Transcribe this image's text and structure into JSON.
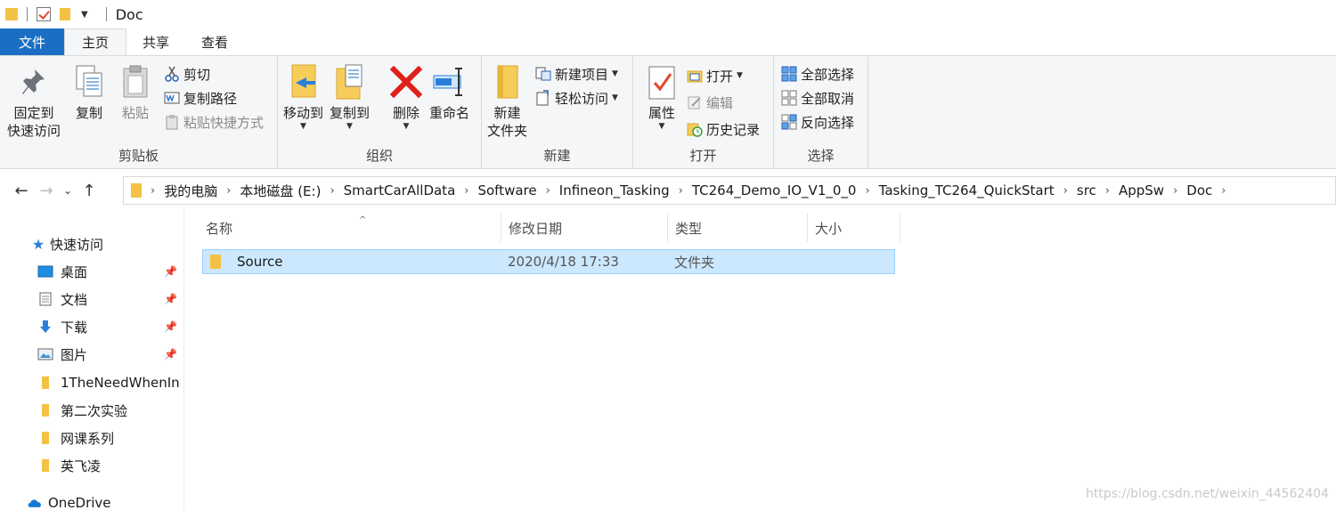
{
  "window": {
    "title": "Doc"
  },
  "tabs": [
    {
      "label": "文件"
    },
    {
      "label": "主页"
    },
    {
      "label": "共享"
    },
    {
      "label": "查看"
    }
  ],
  "ribbon": {
    "clipboard": {
      "label": "剪贴板",
      "pin": "固定到\n快速访问",
      "pin_line1": "固定到",
      "pin_line2": "快速访问",
      "copy": "复制",
      "paste": "粘贴",
      "cut": "剪切",
      "copy_path": "复制路径",
      "paste_shortcut": "粘贴快捷方式"
    },
    "organize": {
      "label": "组织",
      "move_to": "移动到",
      "copy_to": "复制到",
      "delete": "删除",
      "rename": "重命名"
    },
    "new": {
      "label": "新建",
      "new_folder_line1": "新建",
      "new_folder_line2": "文件夹",
      "new_item": "新建项目",
      "easy_access": "轻松访问"
    },
    "open": {
      "label": "打开",
      "properties": "属性",
      "open": "打开",
      "edit": "编辑",
      "history": "历史记录"
    },
    "select": {
      "label": "选择",
      "select_all": "全部选择",
      "select_none": "全部取消",
      "invert": "反向选择"
    }
  },
  "address": {
    "crumbs": [
      "我的电脑",
      "本地磁盘 (E:)",
      "SmartCarAllData",
      "Software",
      "Infineon_Tasking",
      "TC264_Demo_IO_V1_0_0",
      "Tasking_TC264_QuickStart",
      "src",
      "AppSw",
      "Doc"
    ]
  },
  "nav": {
    "quick_access": "快速访问",
    "items": [
      {
        "label": "桌面",
        "pinned": true
      },
      {
        "label": "文档",
        "pinned": true
      },
      {
        "label": "下载",
        "pinned": true
      },
      {
        "label": "图片",
        "pinned": true
      },
      {
        "label": "1TheNeedWhenIn",
        "pinned": false
      },
      {
        "label": "第二次实验",
        "pinned": false
      },
      {
        "label": "网课系列",
        "pinned": false
      },
      {
        "label": "英飞凌",
        "pinned": false
      }
    ],
    "onedrive": "OneDrive"
  },
  "columns": {
    "name": "名称",
    "modified": "修改日期",
    "type": "类型",
    "size": "大小"
  },
  "files": [
    {
      "name": "Source",
      "modified": "2020/4/18 17:33",
      "type": "文件夹",
      "size": ""
    }
  ],
  "watermark": "https://blog.csdn.net/weixin_44562404",
  "colors": {
    "accent": "#1a6fc4",
    "folder": "#f3c244",
    "selection": "#cce8ff",
    "delete_red": "#e0201b"
  }
}
